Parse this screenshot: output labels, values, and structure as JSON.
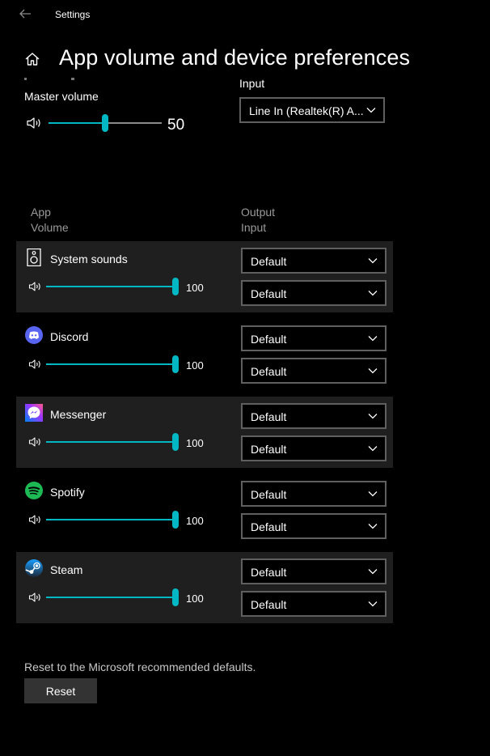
{
  "window": {
    "title": "Settings"
  },
  "page": {
    "title": "App volume and device preferences"
  },
  "master": {
    "label": "Master volume",
    "value": "50",
    "level": 0.5
  },
  "input": {
    "label": "Input",
    "selected": "Line In (Realtek(R) A..."
  },
  "columns": {
    "app": "App",
    "volume": "Volume",
    "output": "Output",
    "input": "Input"
  },
  "apps": [
    {
      "name": "System sounds",
      "icon": "speaker-icon",
      "volume": "100",
      "level": 1,
      "output": "Default",
      "input": "Default",
      "highlight": true
    },
    {
      "name": "Discord",
      "icon": "discord-icon",
      "volume": "100",
      "level": 1,
      "output": "Default",
      "input": "Default",
      "highlight": false
    },
    {
      "name": "Messenger",
      "icon": "messenger-icon",
      "volume": "100",
      "level": 1,
      "output": "Default",
      "input": "Default",
      "highlight": true
    },
    {
      "name": "Spotify",
      "icon": "spotify-icon",
      "volume": "100",
      "level": 1,
      "output": "Default",
      "input": "Default",
      "highlight": false
    },
    {
      "name": "Steam",
      "icon": "steam-icon",
      "volume": "100",
      "level": 1,
      "output": "Default",
      "input": "Default",
      "highlight": true
    }
  ],
  "reset": {
    "description": "Reset to the Microsoft recommended defaults.",
    "button_label": "Reset"
  },
  "colors": {
    "accent": "#00b7c3",
    "discord": "#5865f2",
    "spotify": "#1db954",
    "messenger": "#0084ff"
  }
}
